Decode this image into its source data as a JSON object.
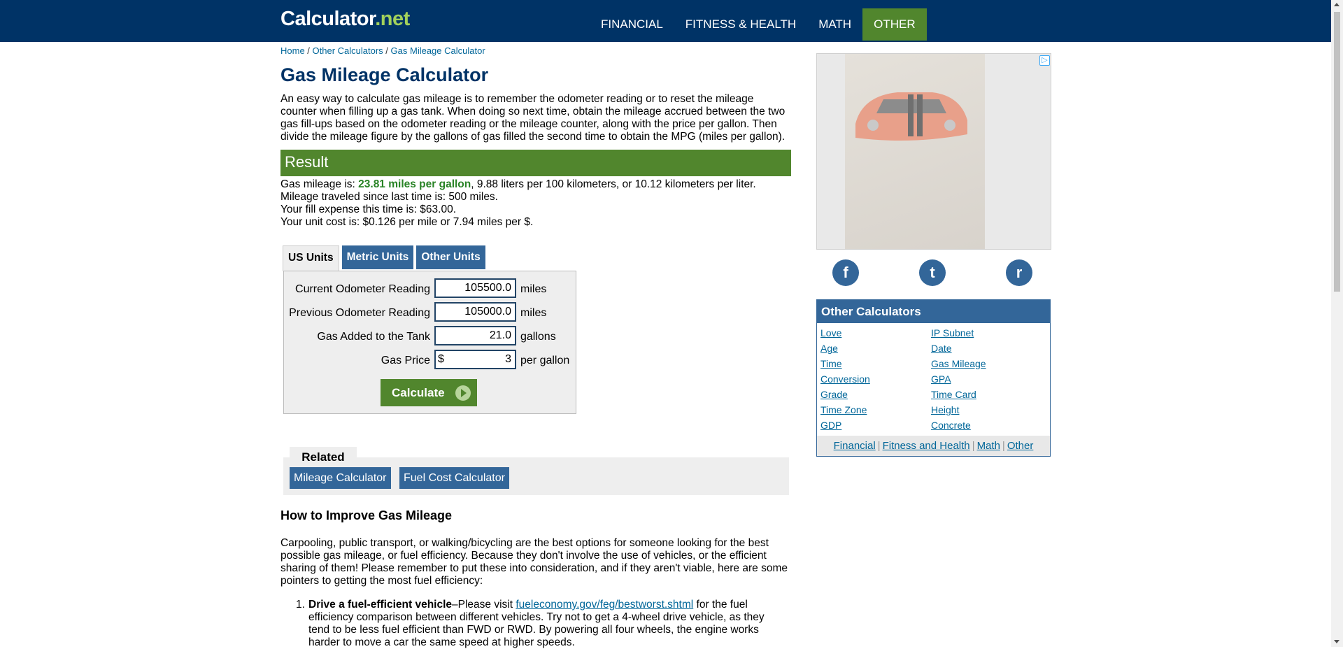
{
  "header": {
    "logo_main": "Calculator",
    "logo_suffix": ".net",
    "nav": [
      "FINANCIAL",
      "FITNESS & HEALTH",
      "MATH",
      "OTHER"
    ]
  },
  "breadcrumb": {
    "home": "Home",
    "sep1": " / ",
    "other": "Other Calculators",
    "sep2": " / ",
    "current": "Gas Mileage Calculator"
  },
  "page_title": "Gas Mileage Calculator",
  "intro": "An easy way to calculate gas mileage is to remember the odometer reading or to reset the mileage counter when filling up a gas tank. When doing so next time, obtain the mileage accrued between the two gas fill-ups based on the odometer reading or the mileage counter, along with the price per gallon. Then divide the mileage figure by the gallons of gas filled the second time to obtain the MPG (miles per gallon).",
  "result": {
    "header": "Result",
    "line1_prefix": "Gas mileage is: ",
    "line1_highlight": "23.81 miles per gallon",
    "line1_suffix": ", 9.88 liters per 100 kilometers, or 10.12 kilometers per liter.",
    "line2": "Mileage traveled since last time is: 500 miles.",
    "line3": "Your fill expense this time is: $63.00.",
    "line4": "Your unit cost is: $0.126 per mile or 7.94 miles per $."
  },
  "tabs": [
    "US Units",
    "Metric Units",
    "Other Units"
  ],
  "form": {
    "current_label": "Current Odometer Reading",
    "current_value": "105500.0",
    "current_unit": "miles",
    "previous_label": "Previous Odometer Reading",
    "previous_value": "105000.0",
    "previous_unit": "miles",
    "gas_label": "Gas Added to the Tank",
    "gas_value": "21.0",
    "gas_unit": "gallons",
    "price_label": "Gas Price",
    "price_prefix": "$",
    "price_value": "3",
    "price_unit": "per gallon",
    "calculate": "Calculate"
  },
  "related": {
    "title": "Related",
    "links": [
      "Mileage Calculator",
      "Fuel Cost Calculator"
    ]
  },
  "improve": {
    "title": "How to Improve Gas Mileage",
    "intro": "Carpooling, public transport, or walking/bicycling are the best options for someone looking for the best possible gas mileage, or fuel efficiency. Because they don't involve the use of vehicles, or the efficient sharing of them! Please remember to put these into consideration, and if they aren't viable, here are some pointers to getting the most fuel efficiency:",
    "item1_num": "1.",
    "item1_bold": "Drive a fuel-efficient vehicle",
    "item1_dash": "–Please visit ",
    "item1_link": "fueleconomy.gov/feg/bestworst.shtml",
    "item1_rest": " for the fuel efficiency comparison between different vehicles. Try not to get a 4-wheel drive vehicle, as they tend to be less fuel efficient than FWD or RWD. By powering all four wheels, the engine works harder to move a car the same speed at higher speeds."
  },
  "ad": {
    "badge": "▷"
  },
  "social": {
    "facebook": "f",
    "twitter": "t",
    "reddit": "r"
  },
  "other_calculators": {
    "title": "Other Calculators",
    "left": [
      "Love",
      "Age",
      "Time",
      "Conversion",
      "Grade",
      "Time Zone",
      "GDP"
    ],
    "right": [
      "IP Subnet",
      "Date",
      "Gas Mileage",
      "GPA",
      "Time Card",
      "Height",
      "Concrete"
    ],
    "footer": [
      "Financial",
      "Fitness and Health",
      "Math",
      "Other"
    ],
    "sep": "|"
  }
}
